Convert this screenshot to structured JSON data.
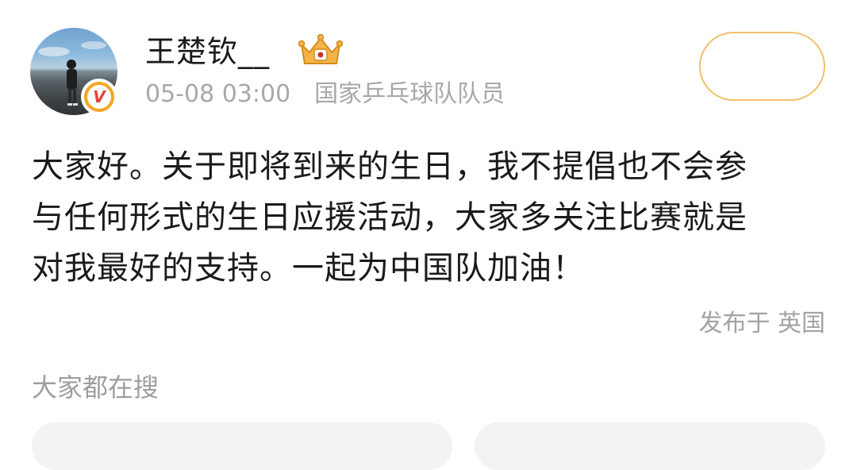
{
  "post": {
    "author": {
      "name": "王楚钦__",
      "avatar_icon": "avatar-photo",
      "verified_icon": "verified-v-icon",
      "badge_icon": "crown-badge-icon"
    },
    "time": "05-08 03:00",
    "source": "国家乒乓球队队员",
    "body_lines": [
      "大家好。关于即将到来的生日，我不提倡也不会参",
      "与任何形式的生日应援活动，大家多关注比赛就是",
      "对我最好的支持。一起为中国队加油！"
    ],
    "location": "发布于 英国"
  },
  "trending": {
    "title": "大家都在搜"
  },
  "colors": {
    "accent_gold": "#f0c069",
    "verified_orange": "#f5a623",
    "verified_red": "#e8403a",
    "meta_gray": "#a8a8a8"
  }
}
